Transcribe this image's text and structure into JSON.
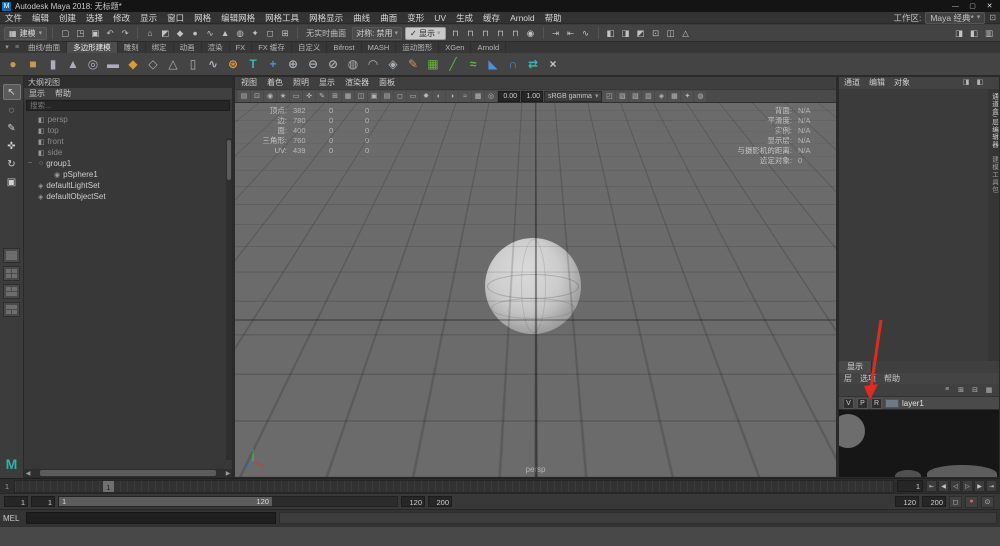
{
  "window": {
    "app_icon_letter": "M",
    "title": "Autodesk Maya 2018: 无标题*",
    "controls": [
      {
        "name": "minimize-button",
        "glyph": "—"
      },
      {
        "name": "maximize-button",
        "glyph": "▢"
      },
      {
        "name": "close-button",
        "glyph": "✕"
      }
    ]
  },
  "menu_bar": {
    "items": [
      "文件",
      "编辑",
      "创建",
      "选择",
      "修改",
      "显示",
      "窗口",
      "网格",
      "编辑网格",
      "网格工具",
      "网格显示",
      "曲线",
      "曲面",
      "变形",
      "UV",
      "生成",
      "缓存",
      "Arnold",
      "帮助"
    ],
    "workspace_label": "工作区:",
    "workspace_value": "Maya 经典*"
  },
  "status_line": {
    "mode": "建模",
    "file_icons": [
      {
        "name": "new-scene-icon",
        "glyph": "▢"
      },
      {
        "name": "open-scene-icon",
        "glyph": "◳"
      },
      {
        "name": "save-scene-icon",
        "glyph": "▣"
      },
      {
        "name": "undo-icon",
        "glyph": "↶"
      },
      {
        "name": "redo-icon",
        "glyph": "↷"
      }
    ],
    "mask_icons": [
      {
        "name": "select-hierarchy-icon",
        "glyph": "⌂"
      },
      {
        "name": "select-object-icon",
        "glyph": "◩"
      },
      {
        "name": "select-component-icon",
        "glyph": "◆"
      },
      {
        "name": "mask-point-icon",
        "glyph": "●"
      },
      {
        "name": "mask-curve-icon",
        "glyph": "∿"
      },
      {
        "name": "mask-surface-icon",
        "glyph": "▲"
      },
      {
        "name": "mask-deformation-icon",
        "glyph": "◍"
      },
      {
        "name": "mask-dynamic-icon",
        "glyph": "✦"
      },
      {
        "name": "mask-rendering-icon",
        "glyph": "◻"
      },
      {
        "name": "mask-misc-icon",
        "glyph": "⊞"
      }
    ],
    "no_live_surface": "无实时曲面",
    "symmetry": "对称: 禁用",
    "display_dropdown": "✓ 显示",
    "snap_icons": [
      {
        "name": "snap-grid-icon",
        "glyph": "⊓"
      },
      {
        "name": "snap-curve-icon",
        "glyph": "⊓"
      },
      {
        "name": "snap-point-icon",
        "glyph": "⊓"
      },
      {
        "name": "snap-projected-center-icon",
        "glyph": "⊓"
      },
      {
        "name": "snap-view-plane-icon",
        "glyph": "⊓"
      },
      {
        "name": "make-live-icon",
        "glyph": "◉"
      }
    ],
    "history_icons": [
      {
        "name": "input-connections-icon",
        "glyph": "⇥"
      },
      {
        "name": "output-connections-icon",
        "glyph": "⇤"
      },
      {
        "name": "construction-history-icon",
        "glyph": "∿"
      }
    ],
    "render_icons": [
      {
        "name": "open-render-view-icon",
        "glyph": "◧"
      },
      {
        "name": "render-frame-icon",
        "glyph": "◨"
      },
      {
        "name": "ipr-render-icon",
        "glyph": "◩"
      },
      {
        "name": "render-settings-icon",
        "glyph": "⊡"
      },
      {
        "name": "hypershade-icon",
        "glyph": "◫"
      },
      {
        "name": "light-editor-icon",
        "glyph": "△"
      }
    ],
    "sidebar_icons": [
      {
        "name": "attribute-editor-toggle-icon",
        "glyph": "◨"
      },
      {
        "name": "tool-settings-toggle-icon",
        "glyph": "◧"
      },
      {
        "name": "channel-box-toggle-icon",
        "glyph": "▥"
      }
    ]
  },
  "shelf": {
    "left_icons": [
      {
        "name": "shelf-menu-icon",
        "glyph": "▾"
      },
      {
        "name": "shelf-tab-options-icon",
        "glyph": "≡"
      }
    ],
    "tabs": [
      {
        "label": "曲线/曲面",
        "state": ""
      },
      {
        "label": "多边形建模",
        "state": "active"
      },
      {
        "label": "雕刻",
        "state": ""
      },
      {
        "label": "绑定",
        "state": ""
      },
      {
        "label": "动画",
        "state": ""
      },
      {
        "label": "渲染",
        "state": ""
      },
      {
        "label": "FX",
        "state": ""
      },
      {
        "label": "FX 缓存",
        "state": ""
      },
      {
        "label": "自定义",
        "state": ""
      },
      {
        "label": "Bifrost",
        "state": ""
      },
      {
        "label": "MASH",
        "state": ""
      },
      {
        "label": "运动图形",
        "state": ""
      },
      {
        "label": "XGen",
        "state": ""
      },
      {
        "label": "Arnold",
        "state": ""
      }
    ],
    "icons": [
      {
        "name": "poly-sphere-icon",
        "glyph": "●",
        "color": "#c59a55"
      },
      {
        "name": "poly-cube-icon",
        "glyph": "■",
        "color": "#c59a55"
      },
      {
        "name": "poly-cylinder-icon",
        "glyph": "▮",
        "color": "#b4aabf"
      },
      {
        "name": "poly-cone-icon",
        "glyph": "▲",
        "color": "#b4aabf"
      },
      {
        "name": "poly-torus-icon",
        "glyph": "◎",
        "color": "#b4aabf"
      },
      {
        "name": "poly-plane-icon",
        "glyph": "▬",
        "color": "#b4aabf"
      },
      {
        "name": "poly-disc-icon",
        "glyph": "◆",
        "color": "#de9a35"
      },
      {
        "name": "poly-platonic-icon",
        "glyph": "◇",
        "color": "#b4aabf"
      },
      {
        "name": "poly-pyramid-icon",
        "glyph": "△",
        "color": "#b4aabf"
      },
      {
        "name": "poly-pipe-icon",
        "glyph": "▯",
        "color": "#b4aabf"
      },
      {
        "name": "poly-helix-icon",
        "glyph": "∿",
        "color": "#b4aabf"
      },
      {
        "name": "poly-gear-icon",
        "glyph": "⊛",
        "color": "#de9a35"
      },
      {
        "name": "type-tool-icon",
        "glyph": "T",
        "color": "#38b8ab"
      },
      {
        "name": "svg-tool-icon",
        "glyph": "+",
        "color": "#4f8fd4"
      },
      {
        "name": "combine-icon",
        "glyph": "⊕",
        "color": "#a8b0b8"
      },
      {
        "name": "separate-icon",
        "glyph": "⊖",
        "color": "#a8b0b8"
      },
      {
        "name": "extract-icon",
        "glyph": "⊘",
        "color": "#a8b0b8"
      },
      {
        "name": "fill-hole-icon",
        "glyph": "◍",
        "color": "#a8b0b8"
      },
      {
        "name": "smooth-icon",
        "glyph": "◠",
        "color": "#a8b0b8"
      },
      {
        "name": "append-polygon-icon",
        "glyph": "◈",
        "color": "#a8b0b8"
      },
      {
        "name": "sculpt-tool-icon",
        "glyph": "✎",
        "color": "#c59a55"
      },
      {
        "name": "quad-draw-icon",
        "glyph": "▦",
        "color": "#69b23b"
      },
      {
        "name": "multi-cut-icon",
        "glyph": "╱",
        "color": "#69b23b"
      },
      {
        "name": "edge-flow-icon",
        "glyph": "≈",
        "color": "#69b23b"
      },
      {
        "name": "bevel-icon",
        "glyph": "◣",
        "color": "#4f8fd4"
      },
      {
        "name": "bridge-icon",
        "glyph": "∩",
        "color": "#4f8fd4"
      },
      {
        "name": "mirror-icon",
        "glyph": "⇄",
        "color": "#38b8ab"
      },
      {
        "name": "delete-history-icon",
        "glyph": "×",
        "color": "#c8c8c8"
      }
    ]
  },
  "toolbox": {
    "tools": [
      {
        "name": "select-tool-icon",
        "glyph": "↖",
        "state": "active"
      },
      {
        "name": "lasso-tool-icon",
        "glyph": "◌",
        "state": ""
      },
      {
        "name": "paint-select-tool-icon",
        "glyph": "✎",
        "state": ""
      },
      {
        "name": "move-tool-icon",
        "glyph": "✜",
        "state": ""
      },
      {
        "name": "rotate-tool-icon",
        "glyph": "↻",
        "state": ""
      },
      {
        "name": "scale-tool-icon",
        "glyph": "▣",
        "state": ""
      }
    ]
  },
  "outliner": {
    "title": "大纲视图",
    "menus": [
      "显示",
      "帮助"
    ],
    "search_placeholder": "搜索...",
    "items": [
      {
        "label": "persp"
      },
      {
        "label": "top"
      },
      {
        "label": "front"
      },
      {
        "label": "side"
      },
      {
        "label": "group1"
      },
      {
        "label": "pSphere1"
      },
      {
        "label": "defaultLightSet"
      },
      {
        "label": "defaultObjectSet"
      }
    ]
  },
  "viewport": {
    "menus": [
      "视图",
      "着色",
      "照明",
      "显示",
      "渲染器",
      "面板"
    ],
    "toolbar": {
      "icons_left": [
        {
          "name": "select-camera-icon",
          "glyph": "▤"
        },
        {
          "name": "lock-camera-icon",
          "glyph": "⊡"
        },
        {
          "name": "camera-attributes-icon",
          "glyph": "◉"
        },
        {
          "name": "bookmarks-icon",
          "glyph": "★"
        },
        {
          "name": "image-plane-icon",
          "glyph": "▭"
        },
        {
          "name": "pan-zoom-icon",
          "glyph": "✜"
        },
        {
          "name": "grease-pencil-icon",
          "glyph": "✎"
        },
        {
          "name": "grid-icon",
          "glyph": "⊞"
        },
        {
          "name": "film-gate-icon",
          "glyph": "▦"
        },
        {
          "name": "resolution-gate-icon",
          "glyph": "◫"
        },
        {
          "name": "gate-mask-icon",
          "glyph": "▣"
        },
        {
          "name": "field-chart-icon",
          "glyph": "▤"
        },
        {
          "name": "safe-action-icon",
          "glyph": "◻"
        },
        {
          "name": "safe-title-icon",
          "glyph": "▭"
        },
        {
          "name": "lighting-icon",
          "glyph": "✸"
        },
        {
          "name": "shadows-icon",
          "glyph": "◐"
        },
        {
          "name": "ambient-occlusion-icon",
          "glyph": "◑"
        },
        {
          "name": "motion-blur-icon",
          "glyph": "≈"
        },
        {
          "name": "multisample-aa-icon",
          "glyph": "▩"
        },
        {
          "name": "depth-of-field-icon",
          "glyph": "◎"
        }
      ],
      "exposure": "0.00",
      "gamma": "1.00",
      "colorspace": "sRGB gamma",
      "icons_right": [
        {
          "name": "isolate-select-icon",
          "glyph": "◰"
        },
        {
          "name": "xray-icon",
          "glyph": "▨"
        },
        {
          "name": "xray-active-icon",
          "glyph": "▧"
        },
        {
          "name": "xray-joints-icon",
          "glyph": "▥"
        },
        {
          "name": "wireframe-on-shaded-icon",
          "glyph": "◈"
        },
        {
          "name": "textured-icon",
          "glyph": "▦"
        },
        {
          "name": "used-lights-icon",
          "glyph": "✦"
        },
        {
          "name": "shadows-toggle-icon",
          "glyph": "◍"
        }
      ]
    },
    "hud_left": [
      {
        "label": "顶点:",
        "v1": "382",
        "v2": "0",
        "v3": "0"
      },
      {
        "label": "边:",
        "v1": "780",
        "v2": "0",
        "v3": "0"
      },
      {
        "label": "面:",
        "v1": "400",
        "v2": "0",
        "v3": "0"
      },
      {
        "label": "三角形:",
        "v1": "760",
        "v2": "0",
        "v3": "0"
      },
      {
        "label": "UV:",
        "v1": "439",
        "v2": "0",
        "v3": "0"
      }
    ],
    "hud_right": [
      {
        "label": "背面:",
        "value": "N/A"
      },
      {
        "label": "平滑度:",
        "value": "N/A"
      },
      {
        "label": "实例:",
        "value": "N/A"
      },
      {
        "label": "显示层:",
        "value": "N/A"
      },
      {
        "label": "与摄影机的距离:",
        "value": "N/A"
      },
      {
        "label": "选定对象:",
        "value": "0"
      }
    ],
    "camera_label": "persp"
  },
  "channel_box": {
    "menus": [
      "通道",
      "编辑",
      "对象"
    ],
    "corner_icons": [
      {
        "name": "channel-slider-mode-icon",
        "glyph": "◨"
      },
      {
        "name": "channel-manipulator-icon",
        "glyph": "◧"
      }
    ],
    "side_tabs": [
      {
        "label": "通道盒/层编辑器",
        "state": "active"
      },
      {
        "label": "建模工具包",
        "state": ""
      }
    ]
  },
  "layer_editor": {
    "tabs": [
      "显示"
    ],
    "menus": [
      "层",
      "选项",
      "帮助"
    ],
    "toolbar_icons": [
      {
        "name": "layer-list-icon",
        "glyph": "≡"
      },
      {
        "name": "new-empty-layer-icon",
        "glyph": "⊞"
      },
      {
        "name": "new-layer-from-selected-icon",
        "glyph": "⊟"
      },
      {
        "name": "layer-options-icon",
        "glyph": "▦"
      }
    ],
    "layers": [
      {
        "visibility": "V",
        "playback": "P",
        "display_type": "R",
        "name": "layer1"
      }
    ]
  },
  "time_slider": {
    "start_tick": "1",
    "current_frame": "1",
    "playback_buttons": [
      {
        "name": "go-to-start-button",
        "glyph": "⇤"
      },
      {
        "name": "step-back-frame-button",
        "glyph": "◀"
      },
      {
        "name": "play-backward-button",
        "glyph": "◁"
      },
      {
        "name": "play-forward-button",
        "glyph": "▷"
      },
      {
        "name": "step-forward-frame-button",
        "glyph": "▶"
      },
      {
        "name": "go-to-end-button",
        "glyph": "⇥"
      }
    ]
  },
  "range_slider": {
    "animation_start": "1",
    "playback_start": "1",
    "bar_start_label": "1",
    "bar_end_label": "120",
    "playback_end": "120",
    "animation_end": "200",
    "playback_end_right": "120",
    "animation_end_right": "200",
    "icons": [
      {
        "name": "character-set-icon",
        "glyph": "◻"
      },
      {
        "name": "auto-keyframe-icon",
        "glyph": "●"
      },
      {
        "name": "animation-preferences-icon",
        "glyph": "⊙"
      }
    ]
  },
  "command_line": {
    "label": "MEL"
  },
  "help_line": {
    "text": ""
  },
  "annotation": {
    "color": "#e02b20"
  }
}
